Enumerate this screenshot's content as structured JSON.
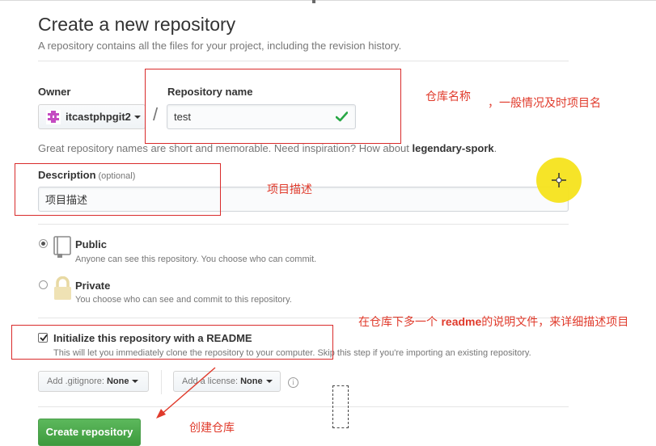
{
  "header": {
    "title": "Create a new repository",
    "subtitle": "A repository contains all the files for your project, including the revision history."
  },
  "owner": {
    "label": "Owner",
    "value": "itcastphpgit2"
  },
  "repository": {
    "label": "Repository name",
    "value": "test",
    "valid": true
  },
  "name_hint": {
    "text": "Great repository names are short and memorable. Need inspiration? How about",
    "suggestion": "legendary-spork",
    "end": "."
  },
  "description": {
    "label": "Description",
    "optional": "(optional)",
    "value": "项目描述"
  },
  "visibility": {
    "public": {
      "label": "Public",
      "note": "Anyone can see this repository. You choose who can commit.",
      "selected": true,
      "icon": "repo-book-icon"
    },
    "private": {
      "label": "Private",
      "note": "You choose who can see and commit to this repository.",
      "selected": false,
      "icon": "lock-icon"
    }
  },
  "readme": {
    "label": "Initialize this repository with a README",
    "note": "This will let you immediately clone the repository to your computer. Skip this step if you're importing an existing repository.",
    "checked": true
  },
  "gitignore": {
    "prefix": "Add .gitignore:",
    "value": "None"
  },
  "license": {
    "prefix": "Add a license:",
    "value": "None"
  },
  "create_button": {
    "label": "Create repository"
  },
  "annotations": {
    "repo_name": "仓库名称",
    "repo_name_extra": "，一般情况及时项目名",
    "description": "项目描述",
    "readme_before": "在仓库下多一个 ",
    "readme_keyword": "readme",
    "readme_after": "的说明文件，来详细描述项目",
    "create": "创建仓库"
  },
  "colors": {
    "annotation_red": "#e03a2b",
    "box_red": "#d92b2b",
    "create_green": "#4cae4c",
    "check_green": "#28a745",
    "cursor_yellow": "#f5e31c"
  }
}
